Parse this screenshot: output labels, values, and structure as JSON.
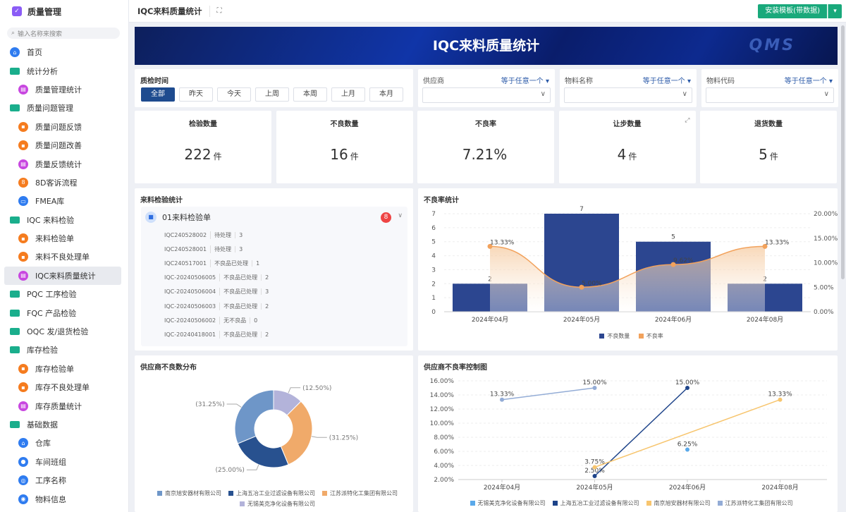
{
  "sidebar": {
    "app_title": "质量管理",
    "search_placeholder": "输入名称来搜索",
    "items": [
      {
        "label": "首页",
        "icon": "home-icon",
        "type": "blue",
        "sub": false
      },
      {
        "label": "统计分析",
        "icon": "folder-icon",
        "type": "folder",
        "sub": false
      },
      {
        "label": "质量管理统计",
        "icon": "chart-icon",
        "type": "purple",
        "sub": true
      },
      {
        "label": "质量问题管理",
        "icon": "folder-icon",
        "type": "folder",
        "sub": false
      },
      {
        "label": "质量问题反馈",
        "icon": "form-icon",
        "type": "orange",
        "sub": true
      },
      {
        "label": "质量问题改善",
        "icon": "form-icon",
        "type": "orange",
        "sub": true
      },
      {
        "label": "质量反馈统计",
        "icon": "chart-icon",
        "type": "purple",
        "sub": true
      },
      {
        "label": "8D客诉流程",
        "icon": "flow-icon",
        "type": "orange",
        "sub": true
      },
      {
        "label": "FMEA库",
        "icon": "table-icon",
        "type": "blue",
        "sub": true
      },
      {
        "label": "IQC 来料检验",
        "icon": "folder-icon",
        "type": "folder",
        "sub": false
      },
      {
        "label": "来料检验单",
        "icon": "form-icon",
        "type": "orange",
        "sub": true
      },
      {
        "label": "来料不良处理单",
        "icon": "form-icon",
        "type": "orange",
        "sub": true
      },
      {
        "label": "IQC来料质量统计",
        "icon": "chart-icon",
        "type": "purple",
        "sub": true,
        "active": true
      },
      {
        "label": "PQC 工序检验",
        "icon": "folder-icon",
        "type": "folder",
        "sub": false
      },
      {
        "label": "FQC 产品检验",
        "icon": "folder-icon",
        "type": "folder",
        "sub": false
      },
      {
        "label": "OQC 发/退货检验",
        "icon": "folder-icon",
        "type": "folder",
        "sub": false
      },
      {
        "label": "库存检验",
        "icon": "folder-icon",
        "type": "folder",
        "sub": false
      },
      {
        "label": "库存检验单",
        "icon": "form-icon",
        "type": "orange",
        "sub": true
      },
      {
        "label": "库存不良处理单",
        "icon": "form-icon",
        "type": "orange",
        "sub": true
      },
      {
        "label": "库存质量统计",
        "icon": "chart-icon",
        "type": "purple",
        "sub": true
      },
      {
        "label": "基础数据",
        "icon": "folder-icon",
        "type": "folder",
        "sub": false
      },
      {
        "label": "仓库",
        "icon": "warehouse-icon",
        "type": "blue",
        "sub": true
      },
      {
        "label": "车间班组",
        "icon": "team-icon",
        "type": "blue",
        "sub": true
      },
      {
        "label": "工序名称",
        "icon": "process-icon",
        "type": "blue",
        "sub": true
      },
      {
        "label": "物料信息",
        "icon": "material-icon",
        "type": "blue",
        "sub": true
      }
    ]
  },
  "topbar": {
    "title": "IQC来料质量统计",
    "template_button": "安装模板(带数据)"
  },
  "banner": {
    "title": "IQC来料质量统计",
    "logo_text": "QMS"
  },
  "filters": {
    "time_label": "质检时间",
    "time_options": [
      "全部",
      "昨天",
      "今天",
      "上周",
      "本周",
      "上月",
      "本月"
    ],
    "time_selected": 0,
    "fields": [
      {
        "label": "供应商",
        "operator": "等于任意一个"
      },
      {
        "label": "物料名称",
        "operator": "等于任意一个"
      },
      {
        "label": "物料代码",
        "operator": "等于任意一个"
      }
    ]
  },
  "kpis": [
    {
      "title": "检验数量",
      "value": "222",
      "unit": "件"
    },
    {
      "title": "不良数量",
      "value": "16",
      "unit": "件"
    },
    {
      "title": "不良率",
      "value": "7.21%",
      "unit": ""
    },
    {
      "title": "让步数量",
      "value": "4",
      "unit": "件"
    },
    {
      "title": "退货数量",
      "value": "5",
      "unit": "件"
    }
  ],
  "inspection": {
    "title": "来料检验统计",
    "group": "01来料检验单",
    "count": "8",
    "rows": [
      [
        "IQC240528002",
        "待处理",
        "3"
      ],
      [
        "IQC240528001",
        "待处理",
        "3"
      ],
      [
        "IQC240517001",
        "不良品已处理",
        "1"
      ],
      [
        "IQC-20240506005",
        "不良品已处理",
        "2"
      ],
      [
        "IQC-20240506004",
        "不良品已处理",
        "3"
      ],
      [
        "IQC-20240506003",
        "不良品已处理",
        "2"
      ],
      [
        "IQC-20240506002",
        "无不良品",
        "0"
      ],
      [
        "IQC-20240418001",
        "不良品已处理",
        "2"
      ]
    ]
  },
  "chart_data": [
    {
      "type": "bar",
      "title": "不良率统计",
      "categories": [
        "2024年04月",
        "2024年05月",
        "2024年06月",
        "2024年08月"
      ],
      "series": [
        {
          "name": "不良数量",
          "type": "bar",
          "values": [
            2,
            7,
            5,
            2
          ],
          "color": "#2c4690"
        },
        {
          "name": "不良率",
          "type": "area-line",
          "values": [
            13.33,
            5.0,
            9.62,
            13.33
          ],
          "labels": [
            "13.33%",
            "5.00%",
            "9.62%",
            "13.33%"
          ],
          "color": "#f2a25c"
        }
      ],
      "yticks": [
        "0",
        "1",
        "2",
        "3",
        "4",
        "5",
        "6",
        "7"
      ],
      "ylim": [
        0,
        7
      ],
      "y2ticks": [
        "0.00%",
        "5.00%",
        "10.00%",
        "15.00%",
        "20.00%"
      ],
      "y2lim": [
        0,
        20
      ],
      "legend": "bottom"
    },
    {
      "type": "pie",
      "title": "供应商不良数分布",
      "slices": [
        {
          "name": "无锡美克净化设备有限公司",
          "value": 12.5,
          "label": "(12.50%)",
          "color": "#b3b3da"
        },
        {
          "name": "江苏派特化工集团有限公司",
          "value": 31.25,
          "label": "(31.25%)",
          "color": "#f0aa6a"
        },
        {
          "name": "上海五冶工业过滤设备有限公司",
          "value": 25,
          "label": "(25.00%)",
          "color": "#28518f"
        },
        {
          "name": "南京旭安器材有限公司",
          "value": 31.25,
          "label": "(31.25%)",
          "color": "#6e96c8"
        }
      ],
      "legend_order": [
        "南京旭安器材有限公司",
        "上海五冶工业过滤设备有限公司",
        "江苏派特化工集团有限公司",
        "无锡美克净化设备有限公司"
      ],
      "legend": "bottom"
    },
    {
      "type": "line",
      "title": "供应商不良率控制图",
      "categories": [
        "2024年04月",
        "2024年05月",
        "2024年06月",
        "2024年08月"
      ],
      "series": [
        {
          "name": "无锡美克净化设备有限公司",
          "values": [
            null,
            null,
            6.25,
            null
          ],
          "color": "#5aa9ea"
        },
        {
          "name": "上海五冶工业过滤设备有限公司",
          "values": [
            null,
            2.5,
            15.0,
            null
          ],
          "color": "#1d4389"
        },
        {
          "name": "南京旭安器材有限公司",
          "values": [
            null,
            3.75,
            null,
            13.33
          ],
          "color": "#f7c56e"
        },
        {
          "name": "江苏派特化工集团有限公司",
          "values": [
            13.33,
            15.0,
            null,
            null
          ],
          "color": "#93acd6"
        }
      ],
      "yticks": [
        "2.00%",
        "4.00%",
        "6.00%",
        "8.00%",
        "10.00%",
        "12.00%",
        "14.00%",
        "16.00%"
      ],
      "ylim": [
        2,
        16
      ],
      "legend": "bottom"
    }
  ]
}
